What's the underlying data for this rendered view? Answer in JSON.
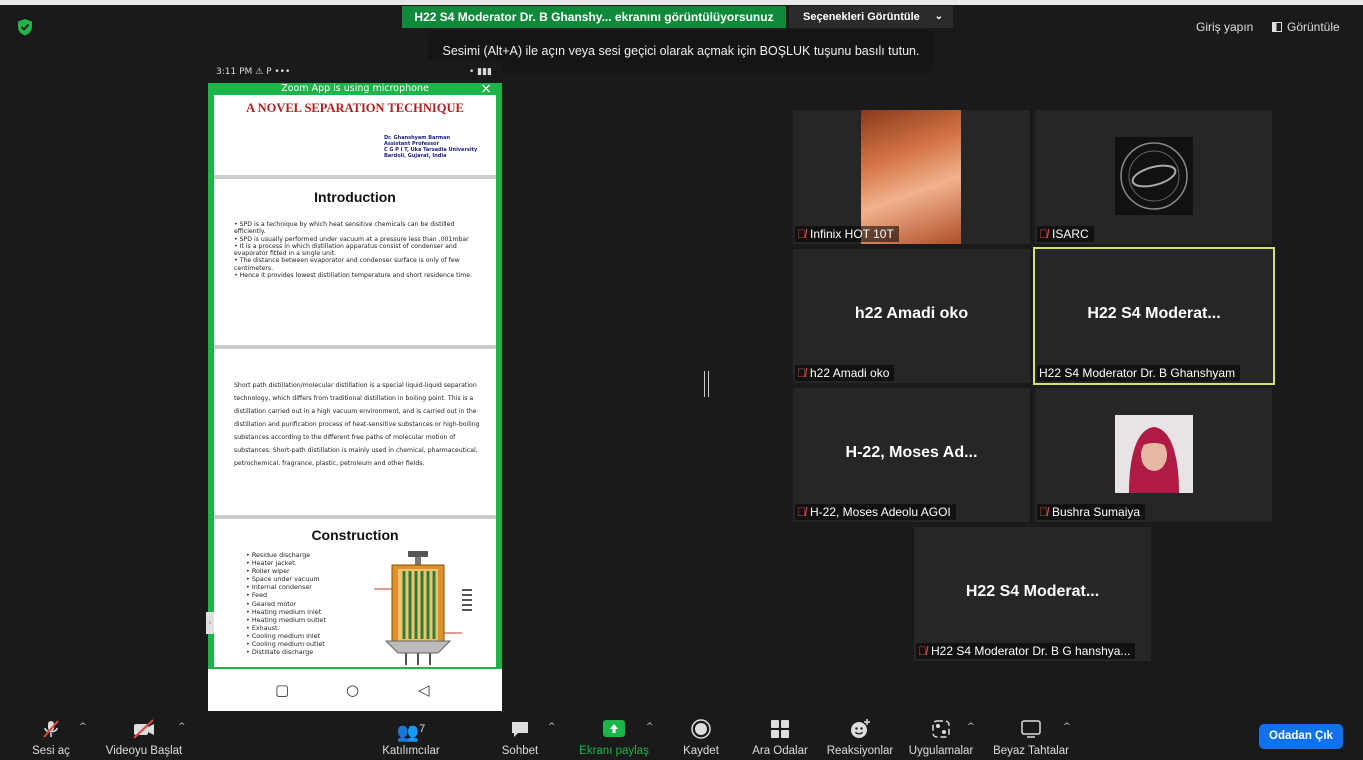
{
  "top": {
    "share_banner": "H22 S4 Moderator Dr. B Ghanshy... ekranını görüntülüyorsunuz",
    "view_options": "Seçenekleri Görüntüle",
    "tooltip": "Sesimi (Alt+A) ile açın veya sesi geçici olarak açmak için BOŞLUK tuşunu basılı tutun.",
    "signin": "Giriş yapın",
    "view": "Görüntüle"
  },
  "phone": {
    "time": "3:11 PM",
    "status_icons": "⚠ P •••",
    "status_right": "• ▮▮▮",
    "mic_banner": "Zoom App is using microphone",
    "slide1": {
      "title": "A NOVEL SEPARATION TECHNIQUE",
      "author": [
        "Dr. Ghanshyam Barman",
        "Assistant Professor",
        "C G P I T, Uka Tarsadia University",
        "Bardoli, Gujarat, India"
      ]
    },
    "slide2": {
      "heading": "Introduction",
      "bullets": [
        "•  SPD is a technique by which heat sensitive chemicals can be distilled efficiently.",
        "•  SPD is usually performed under vacuum at a pressure less than .001mbar",
        "•  It is a process in which distillation apparatus consist of condenser and evaporator fitted in a single unit.",
        "•  The distance between evaporator and condenser surface is only of few centimeters.",
        "•  Hence it provides lowest distillation temperature and short residence time."
      ]
    },
    "slide3": {
      "paragraph": "Short path distillation/molecular distillation is a special liquid-liquid separation technology, which differs from traditional distillation in boiling point. This is a distillation carried out in a high vacuum environment, and is carried out in the distillation and purification process of heat-sensitive substances or high-boiling substances according to the different free paths of molecular motion of substances. Short-path distillation is mainly used in chemical, pharmaceutical, petrochemical, fragrance, plastic, petroleum and other fields."
    },
    "slide4": {
      "heading": "Construction",
      "items": [
        "Residue discharge",
        "Heater jacket.",
        "Roller wiper",
        "Space under vacuum",
        "Internal condenser",
        "Feed",
        "Geared motor",
        "Heating medium inlet",
        "Heating medium outlet",
        "Exhaust.",
        "Cooling medium inlet",
        "Cooling medium outlet",
        "Distillate discharge"
      ]
    },
    "nav": {
      "recent": "▢",
      "home": "○",
      "back": "◁"
    }
  },
  "tiles": [
    {
      "label": "Infinix HOT 10T",
      "big": ""
    },
    {
      "label": "ISARC",
      "big": ""
    },
    {
      "label": "h22 Amadi oko",
      "big": "h22 Amadi oko"
    },
    {
      "label": "H22 S4 Moderator Dr. B Ghanshyam",
      "big": "H22 S4 Moderat..."
    },
    {
      "label": "H-22, Moses Adeolu AGOI",
      "big": "H-22, Moses Ad..."
    },
    {
      "label": "Bushra Sumaiya",
      "big": ""
    },
    {
      "label": "H22 S4 Moderator Dr. B G hanshya...",
      "big": "H22 S4 Moderat..."
    }
  ],
  "toolbar": {
    "unmute": "Sesi aç",
    "start_video": "Videoyu Başlat",
    "participants": "Katılımcılar",
    "participants_count": "7",
    "chat": "Sohbet",
    "share": "Ekranı paylaş",
    "record": "Kaydet",
    "breakout": "Ara Odalar",
    "reactions": "Reaksiyonlar",
    "apps": "Uygulamalar",
    "whiteboard": "Beyaz Tahtalar",
    "leave": "Odadan Çık"
  },
  "colors": {
    "share_green": "#0f8a3a",
    "leave_blue": "#0e72ed",
    "active_speaker": "#d6e36d",
    "mute_red": "#e0443e"
  }
}
